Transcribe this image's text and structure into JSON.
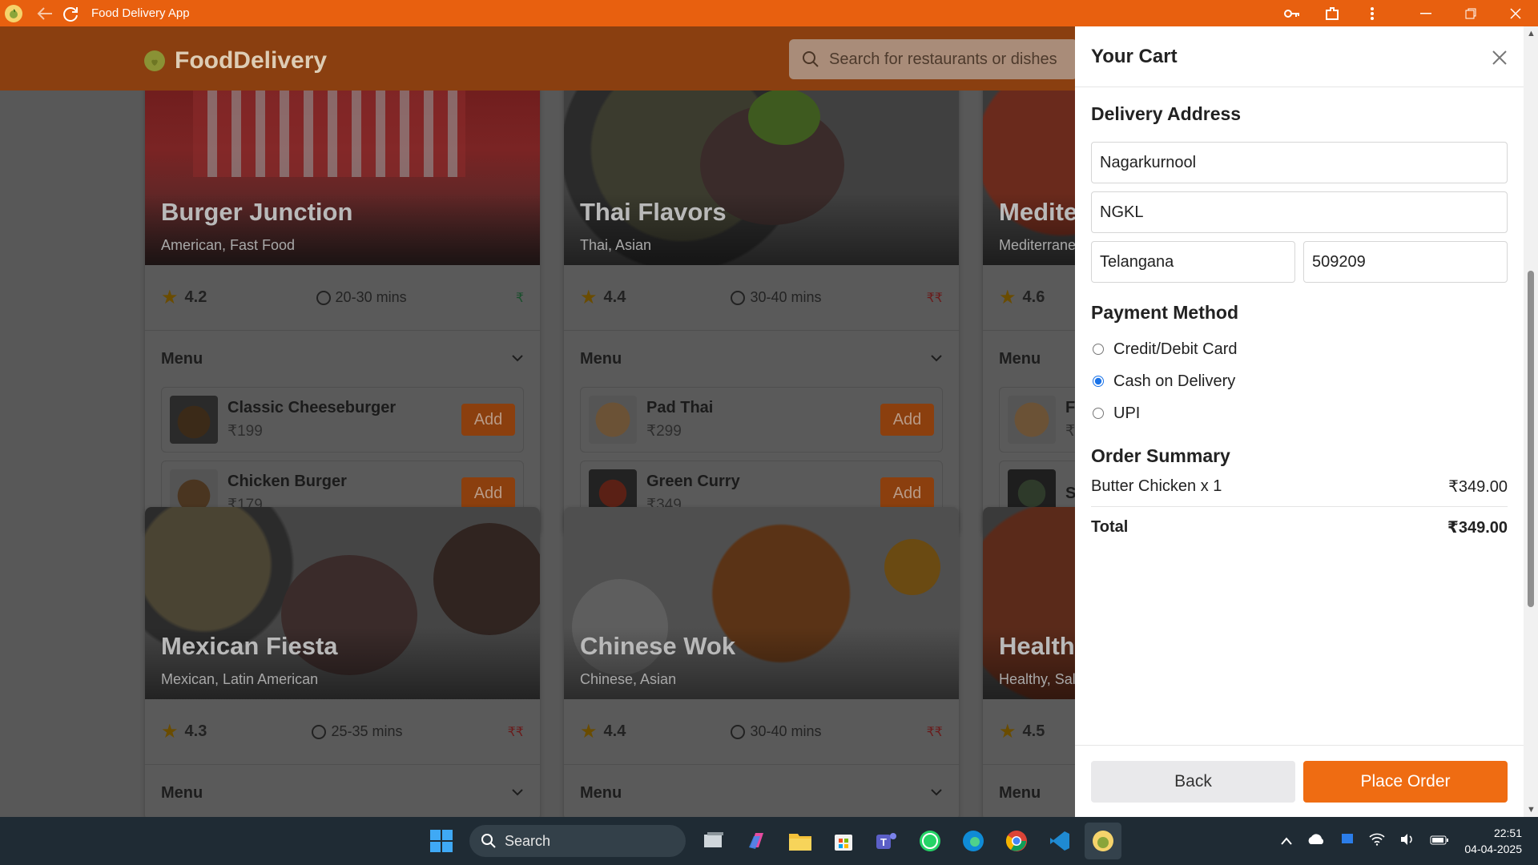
{
  "window": {
    "title": "Food Delivery App"
  },
  "header": {
    "brand": "FoodDelivery",
    "search_placeholder": "Search for restaurants or dishes"
  },
  "restaurants": [
    {
      "name": "Burger Junction",
      "cuisine": "American, Fast Food",
      "rating": "4.2",
      "time": "20-30 mins",
      "price": "₹",
      "menu_label": "Menu",
      "items": [
        {
          "name": "Classic Cheeseburger",
          "price": "₹199",
          "add": "Add"
        },
        {
          "name": "Chicken Burger",
          "price": "₹179",
          "add": "Add"
        }
      ]
    },
    {
      "name": "Thai Flavors",
      "cuisine": "Thai, Asian",
      "rating": "4.4",
      "time": "30-40 mins",
      "price": "₹₹",
      "menu_label": "Menu",
      "items": [
        {
          "name": "Pad Thai",
          "price": "₹299",
          "add": "Add"
        },
        {
          "name": "Green Curry",
          "price": "₹349",
          "add": "Add"
        }
      ]
    },
    {
      "name": "Medite",
      "cuisine": "Mediterrane",
      "rating": "4.6",
      "menu_label": "Menu",
      "items": [
        {
          "name": "Fa",
          "price": "₹"
        },
        {
          "name": "Sl",
          "price": ""
        }
      ]
    },
    {
      "name": "Mexican Fiesta",
      "cuisine": "Mexican, Latin American",
      "rating": "4.3",
      "time": "25-35 mins",
      "price": "₹₹",
      "menu_label": "Menu"
    },
    {
      "name": "Chinese Wok",
      "cuisine": "Chinese, Asian",
      "rating": "4.4",
      "time": "30-40 mins",
      "price": "₹₹",
      "menu_label": "Menu"
    },
    {
      "name": "Health",
      "cuisine": "Healthy, Sala",
      "rating": "4.5",
      "menu_label": "Menu"
    }
  ],
  "cart": {
    "title": "Your Cart",
    "delivery_title": "Delivery Address",
    "address_line1": "Nagarkurnool",
    "address_line2": "NGKL",
    "state": "Telangana",
    "pincode": "509209",
    "payment_title": "Payment Method",
    "payment_options": [
      "Credit/Debit Card",
      "Cash on Delivery",
      "UPI"
    ],
    "payment_selected": "Cash on Delivery",
    "summary_title": "Order Summary",
    "summary_items": [
      {
        "label": "Butter Chicken x 1",
        "amount": "₹349.00"
      }
    ],
    "total_label": "Total",
    "total_amount": "₹349.00",
    "back_label": "Back",
    "place_label": "Place Order"
  },
  "taskbar": {
    "search_label": "Search",
    "time": "22:51",
    "date": "04-04-2025"
  },
  "colors": {
    "titlebar": "#e8600f",
    "accent": "#ef6c12",
    "taskbar": "#1f2b34"
  }
}
